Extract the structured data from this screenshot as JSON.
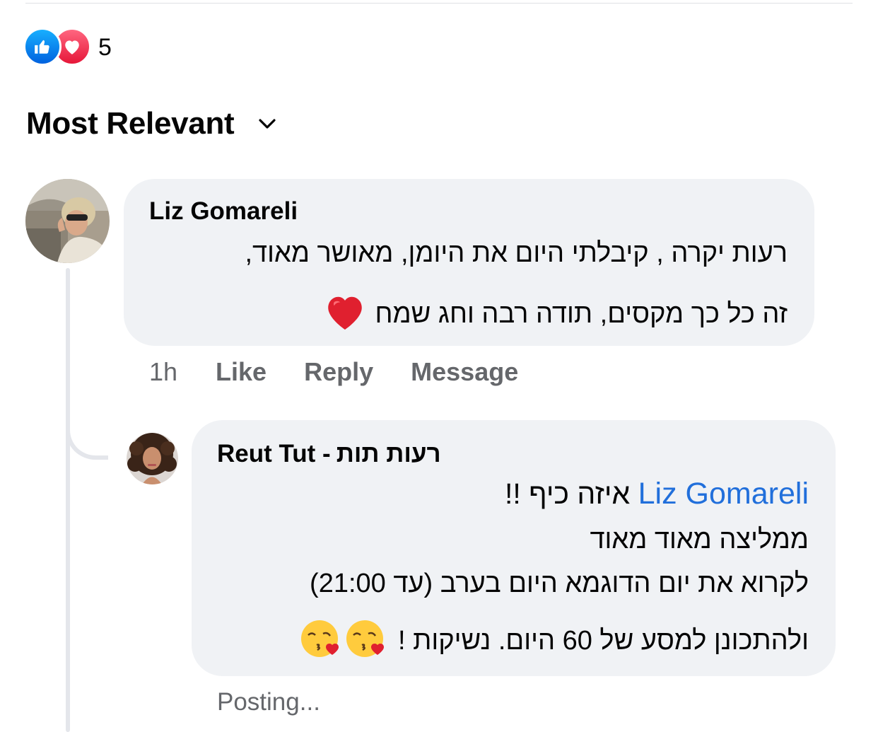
{
  "reactions": {
    "icons": [
      "like-icon",
      "love-icon"
    ],
    "count": "5",
    "colors": {
      "like": "#1877f2",
      "love": "#f33e58"
    }
  },
  "sort": {
    "label": "Most Relevant",
    "icon": "chevron-down-icon"
  },
  "comments": [
    {
      "author": "Liz Gomareli",
      "lines": [
        "רעות יקרה , קיבלתי היום את היומן, מאושר מאוד,",
        "זה כל כך מקסים, תודה רבה וחג שמח",
        "❤️"
      ],
      "time": "1h",
      "actions": [
        "Like",
        "Reply",
        "Message"
      ]
    }
  ],
  "reply": {
    "author": "Reut Tut -",
    "author_he": "רעות  תות",
    "mention": "Liz Gomareli",
    "lines": [
      "איזה כיף !!",
      "ממליצה מאוד מאוד",
      "לקרוא את יום הדוגמא היום בערב (עד 21:00)",
      "ולהתכונן למסע של 60 היום. נשיקות !",
      "😘😘"
    ],
    "status": "Posting..."
  },
  "colors": {
    "bubble": "#f0f2f5",
    "secondary_text": "#65676b",
    "link": "#216fdb",
    "thread_line": "#e4e6eb"
  }
}
